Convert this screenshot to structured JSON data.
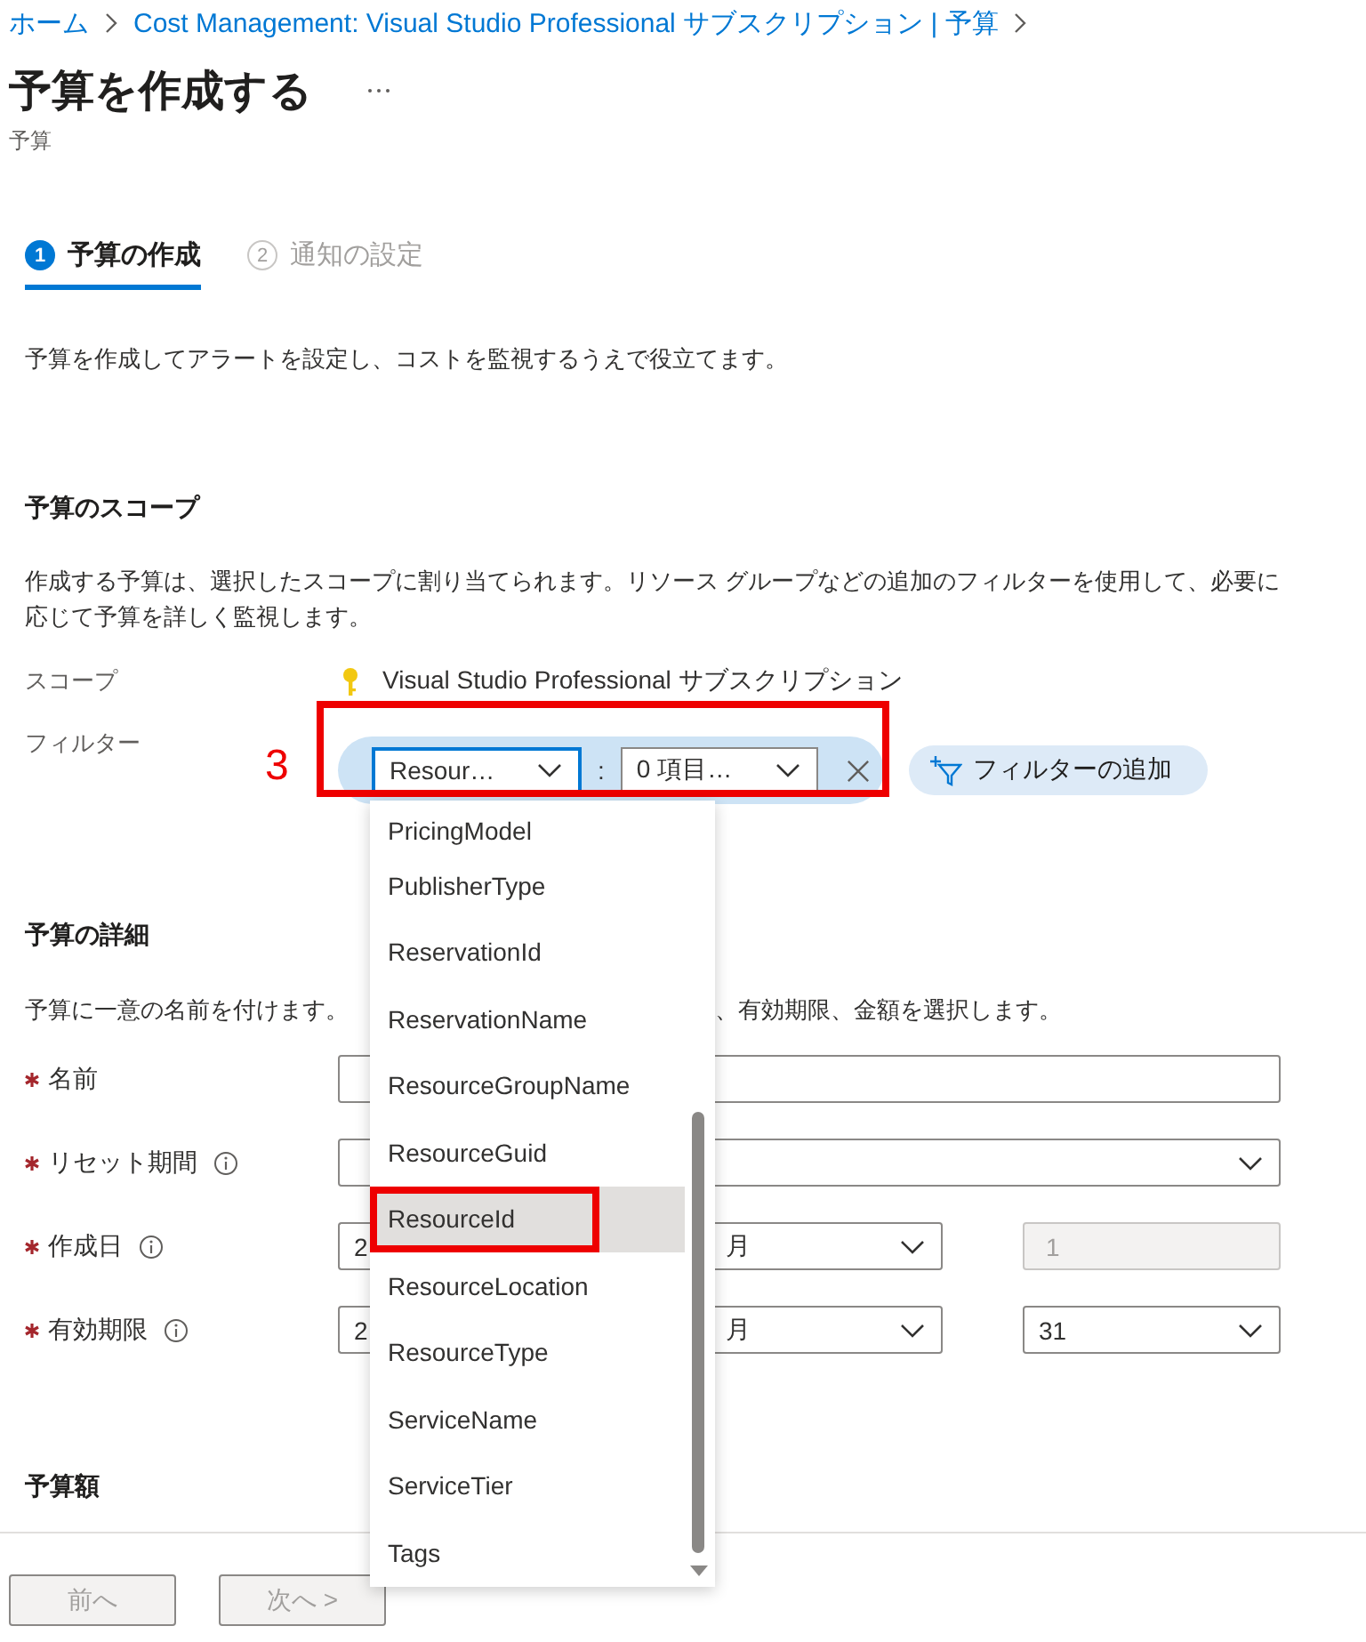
{
  "breadcrumb": [
    "ホーム",
    "Cost Management: Visual Studio Professional サブスクリプション | 予算"
  ],
  "title": "予算を作成する",
  "subtitle": "予算",
  "steps": [
    {
      "number": "1",
      "label": "予算の作成",
      "selected": true
    },
    {
      "number": "2",
      "label": "通知の設定",
      "selected": false
    }
  ],
  "description": "予算を作成してアラートを設定し、コストを監視するうえで役立てます。",
  "scope_section": {
    "heading": "予算のスコープ",
    "text": "作成する予算は、選択したスコープに割り当てられます。リソース グループなどの追加のフィルターを使用して、必要に応じて予算を詳しく監視します。",
    "scope": {
      "label": "スコープ",
      "value": "Visual Studio Professional サブスクリプション"
    },
    "filter": {
      "label": "フィルター",
      "annotation": "3",
      "key_select": "Resour…",
      "separator": ":",
      "value_select": "0 項目…",
      "add_button": "フィルターの追加"
    }
  },
  "dropdown": {
    "items": [
      {
        "label": "PricingModel",
        "selected": false,
        "annotated": false
      },
      {
        "label": "PublisherType",
        "selected": false,
        "annotated": false
      },
      {
        "label": "ReservationId",
        "selected": false,
        "annotated": false
      },
      {
        "label": "ReservationName",
        "selected": false,
        "annotated": false
      },
      {
        "label": "ResourceGroupName",
        "selected": false,
        "annotated": false
      },
      {
        "label": "ResourceGuid",
        "selected": false,
        "annotated": false
      },
      {
        "label": "ResourceId",
        "selected": true,
        "annotated": true
      },
      {
        "label": "ResourceLocation",
        "selected": false,
        "annotated": false
      },
      {
        "label": "ResourceType",
        "selected": false,
        "annotated": false
      },
      {
        "label": "ServiceName",
        "selected": false,
        "annotated": false
      },
      {
        "label": "ServiceTier",
        "selected": false,
        "annotated": false
      },
      {
        "label": "Tags",
        "selected": false,
        "annotated": false
      }
    ]
  },
  "details_section": {
    "heading": "予算の詳細",
    "text_left": "予算に一意の名前を付けます。",
    "text_right": "、有効期限、金額を選択します。",
    "fields": [
      {
        "label": "名前",
        "required": true,
        "info": false,
        "parts": [
          {
            "kind": "input"
          }
        ]
      },
      {
        "label": "リセット期間",
        "required": true,
        "info": true,
        "parts": [
          {
            "kind": "select"
          }
        ]
      },
      {
        "label": "作成日",
        "required": true,
        "info": true,
        "parts": [
          {
            "kind": "select",
            "value": "2"
          },
          {
            "kind": "select",
            "value": "月"
          },
          {
            "kind": "input",
            "value": "1",
            "disabled": true
          }
        ]
      },
      {
        "label": "有効期限",
        "required": true,
        "info": true,
        "parts": [
          {
            "kind": "select",
            "value": "2"
          },
          {
            "kind": "select",
            "value": "月"
          },
          {
            "kind": "select",
            "value": "31"
          }
        ]
      }
    ]
  },
  "amount_section": {
    "heading": "予算額"
  },
  "buttons": [
    {
      "label": "前へ",
      "disabled": true
    },
    {
      "label": "次へ >",
      "disabled": true
    }
  ]
}
